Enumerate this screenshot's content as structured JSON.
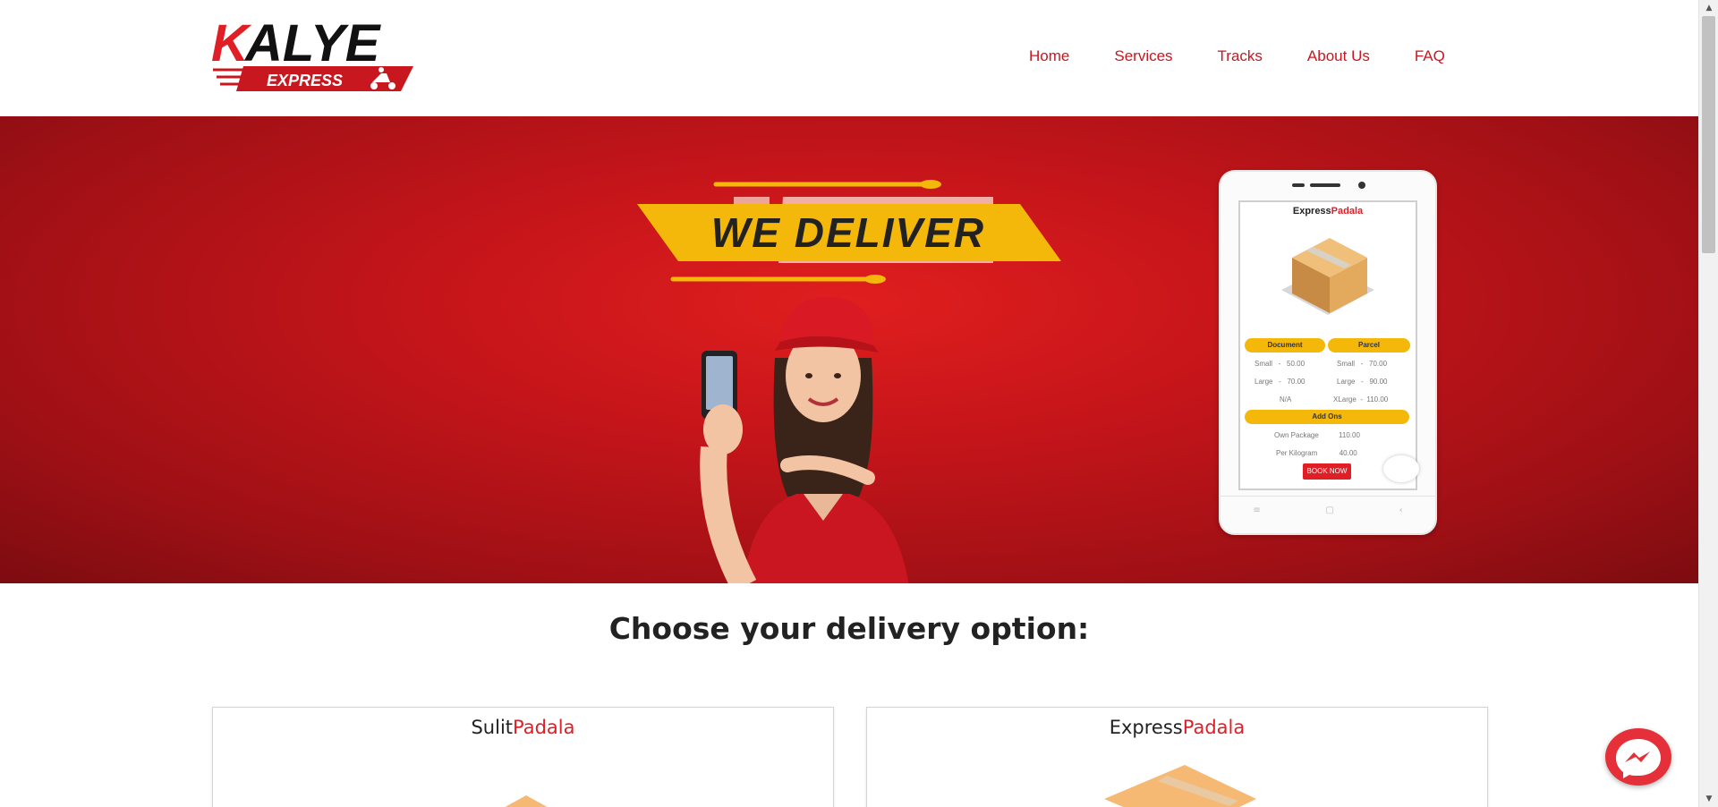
{
  "brand": {
    "name_first_letter": "K",
    "name_rest": "ALYE",
    "tagline": "EXPRESS"
  },
  "nav": {
    "items": [
      "Home",
      "Services",
      "Tracks",
      "About Us",
      "FAQ"
    ]
  },
  "hero": {
    "banner_text": "WE DELIVER",
    "phone": {
      "title_black": "Express",
      "title_red": "Padala",
      "pills": {
        "document": "Document",
        "parcel": "Parcel",
        "addons": "Add Ons"
      },
      "document_rows": [
        {
          "size": "Small",
          "sep": "-",
          "price": "50.00"
        },
        {
          "size": "Large",
          "sep": "-",
          "price": "70.00"
        },
        {
          "size": "N/A",
          "sep": "",
          "price": ""
        }
      ],
      "parcel_rows": [
        {
          "size": "Small",
          "sep": "-",
          "price": "70.00"
        },
        {
          "size": "Large",
          "sep": "-",
          "price": "90.00"
        },
        {
          "size": "XLarge",
          "sep": "-",
          "price": "110.00"
        }
      ],
      "addon_rows": [
        {
          "label": "Own Package",
          "price": "110.00"
        },
        {
          "label": "Per Kilogram",
          "price": "40.00"
        }
      ],
      "book_button": "BOOK NOW"
    }
  },
  "section": {
    "title": "Choose your delivery option:"
  },
  "cards": [
    {
      "title_black": "Sulit",
      "title_red": "Padala"
    },
    {
      "title_black": "Express",
      "title_red": "Padala"
    }
  ],
  "colors": {
    "brand_red": "#e01e26",
    "nav_red": "#c8171f",
    "yellow": "#f4b80b",
    "hero_dark": "#7c0c10"
  },
  "icons": {
    "chat": "messenger-icon",
    "scroll_up": "triangle-up-icon",
    "scroll_down": "triangle-down-icon"
  }
}
